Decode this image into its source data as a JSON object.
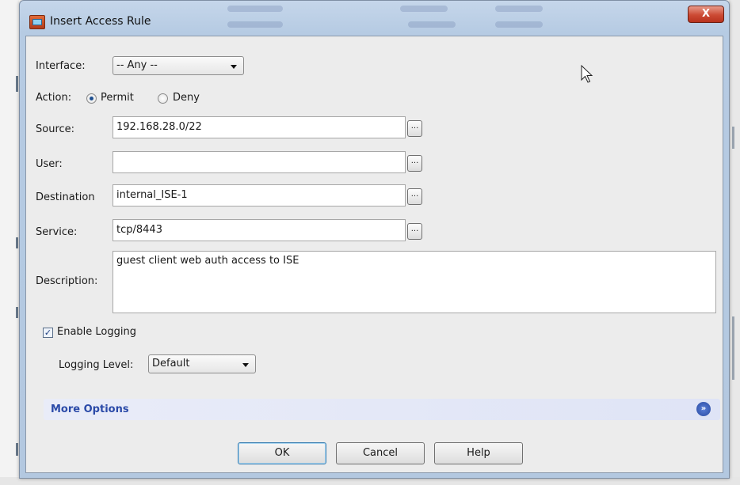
{
  "window": {
    "title": "Insert Access Rule",
    "close_glyph": "X"
  },
  "form": {
    "interface": {
      "label": "Interface:",
      "value": "-- Any --"
    },
    "action": {
      "label": "Action:",
      "options": [
        "Permit",
        "Deny"
      ],
      "selected": "Permit"
    },
    "source": {
      "label": "Source:",
      "value": "192.168.28.0/22"
    },
    "user": {
      "label": "User:",
      "value": ""
    },
    "destination": {
      "label": "Destination",
      "value": "internal_ISE-1"
    },
    "service": {
      "label": "Service:",
      "value": "tcp/8443"
    },
    "description": {
      "label": "Description:",
      "value": "guest client web auth access to ISE"
    },
    "browse_glyph": "...",
    "logging": {
      "enable_label": "Enable Logging",
      "enabled": true,
      "level_label": "Logging Level:",
      "level_value": "Default"
    },
    "more_options": {
      "label": "More Options",
      "toggle_glyph": "»"
    }
  },
  "buttons": {
    "ok": "OK",
    "cancel": "Cancel",
    "help": "Help"
  },
  "icons": [
    "app-icon",
    "close-icon",
    "browse-icon",
    "chevron-double-down-icon",
    "dropdown-arrow-icon",
    "mouse-cursor-icon"
  ],
  "colors": {
    "title_bar": "#b8cce4",
    "close_button": "#c94a33",
    "more_options_text": "#2a4aa8",
    "client_bg": "#ececec"
  }
}
